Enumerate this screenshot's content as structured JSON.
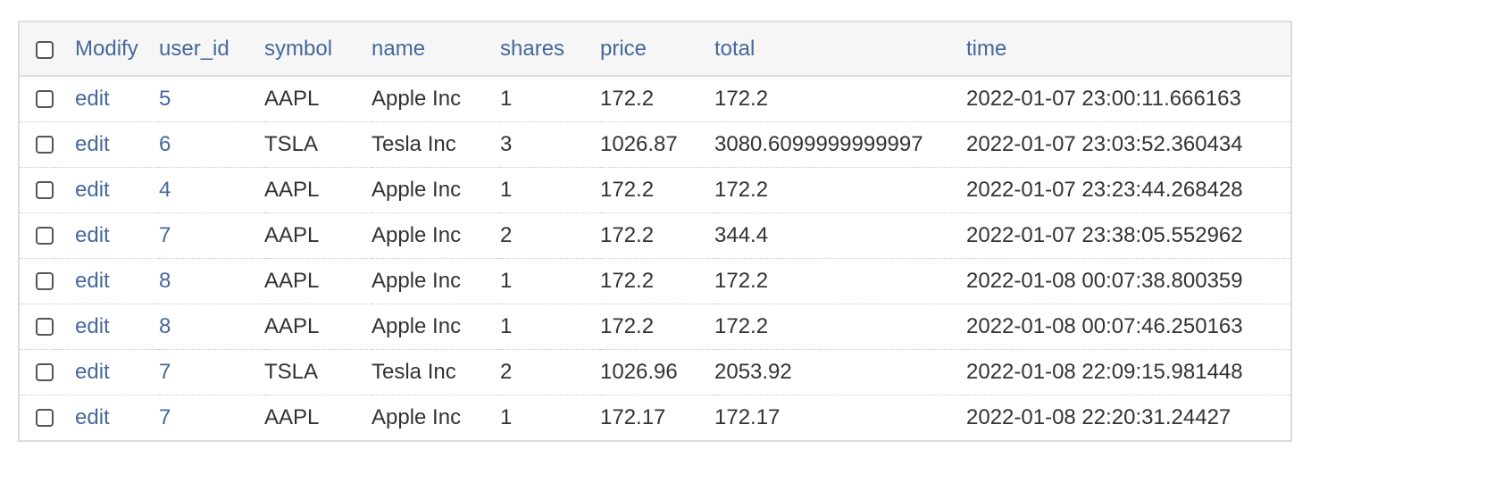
{
  "table": {
    "headers": {
      "modify": "Modify",
      "user_id": "user_id",
      "symbol": "symbol",
      "name": "name",
      "shares": "shares",
      "price": "price",
      "total": "total",
      "time": "time"
    },
    "rows": [
      {
        "edit": "edit",
        "user_id": "5",
        "symbol": "AAPL",
        "name": "Apple Inc",
        "shares": "1",
        "price": "172.2",
        "total": "172.2",
        "time": "2022-01-07 23:00:11.666163"
      },
      {
        "edit": "edit",
        "user_id": "6",
        "symbol": "TSLA",
        "name": "Tesla Inc",
        "shares": "3",
        "price": "1026.87",
        "total": "3080.6099999999997",
        "time": "2022-01-07 23:03:52.360434"
      },
      {
        "edit": "edit",
        "user_id": "4",
        "symbol": "AAPL",
        "name": "Apple Inc",
        "shares": "1",
        "price": "172.2",
        "total": "172.2",
        "time": "2022-01-07 23:23:44.268428"
      },
      {
        "edit": "edit",
        "user_id": "7",
        "symbol": "AAPL",
        "name": "Apple Inc",
        "shares": "2",
        "price": "172.2",
        "total": "344.4",
        "time": "2022-01-07 23:38:05.552962"
      },
      {
        "edit": "edit",
        "user_id": "8",
        "symbol": "AAPL",
        "name": "Apple Inc",
        "shares": "1",
        "price": "172.2",
        "total": "172.2",
        "time": "2022-01-08 00:07:38.800359"
      },
      {
        "edit": "edit",
        "user_id": "8",
        "symbol": "AAPL",
        "name": "Apple Inc",
        "shares": "1",
        "price": "172.2",
        "total": "172.2",
        "time": "2022-01-08 00:07:46.250163"
      },
      {
        "edit": "edit",
        "user_id": "7",
        "symbol": "TSLA",
        "name": "Tesla Inc",
        "shares": "2",
        "price": "1026.96",
        "total": "2053.92",
        "time": "2022-01-08 22:09:15.981448"
      },
      {
        "edit": "edit",
        "user_id": "7",
        "symbol": "AAPL",
        "name": "Apple Inc",
        "shares": "1",
        "price": "172.17",
        "total": "172.17",
        "time": "2022-01-08 22:20:31.24427"
      }
    ]
  },
  "colors": {
    "link": "#45689a",
    "header_bg": "#f6f6f6",
    "border": "#dcdcdc",
    "text": "#333333"
  }
}
